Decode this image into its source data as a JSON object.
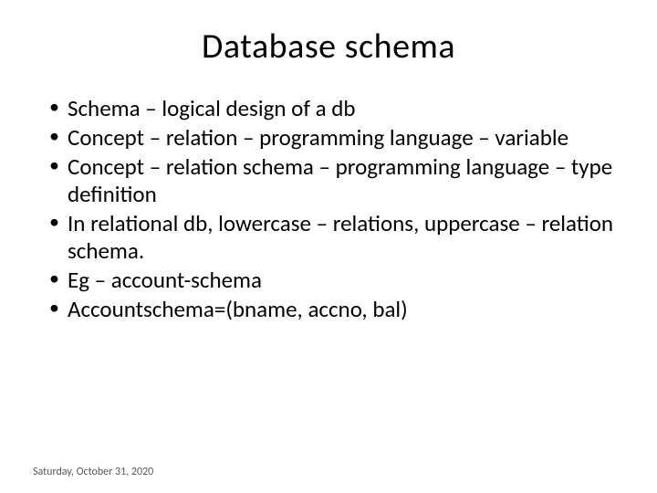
{
  "slide": {
    "title": "Database schema",
    "bullets": [
      "Schema – logical design of a db",
      "Concept – relation – programming language – variable",
      "Concept – relation schema – programming language – type definition",
      "In relational db, lowercase – relations, uppercase – relation schema.",
      "Eg – account-schema",
      "Accountschema=(bname, accno, bal)"
    ],
    "footer_date": "Saturday, October 31, 2020"
  }
}
